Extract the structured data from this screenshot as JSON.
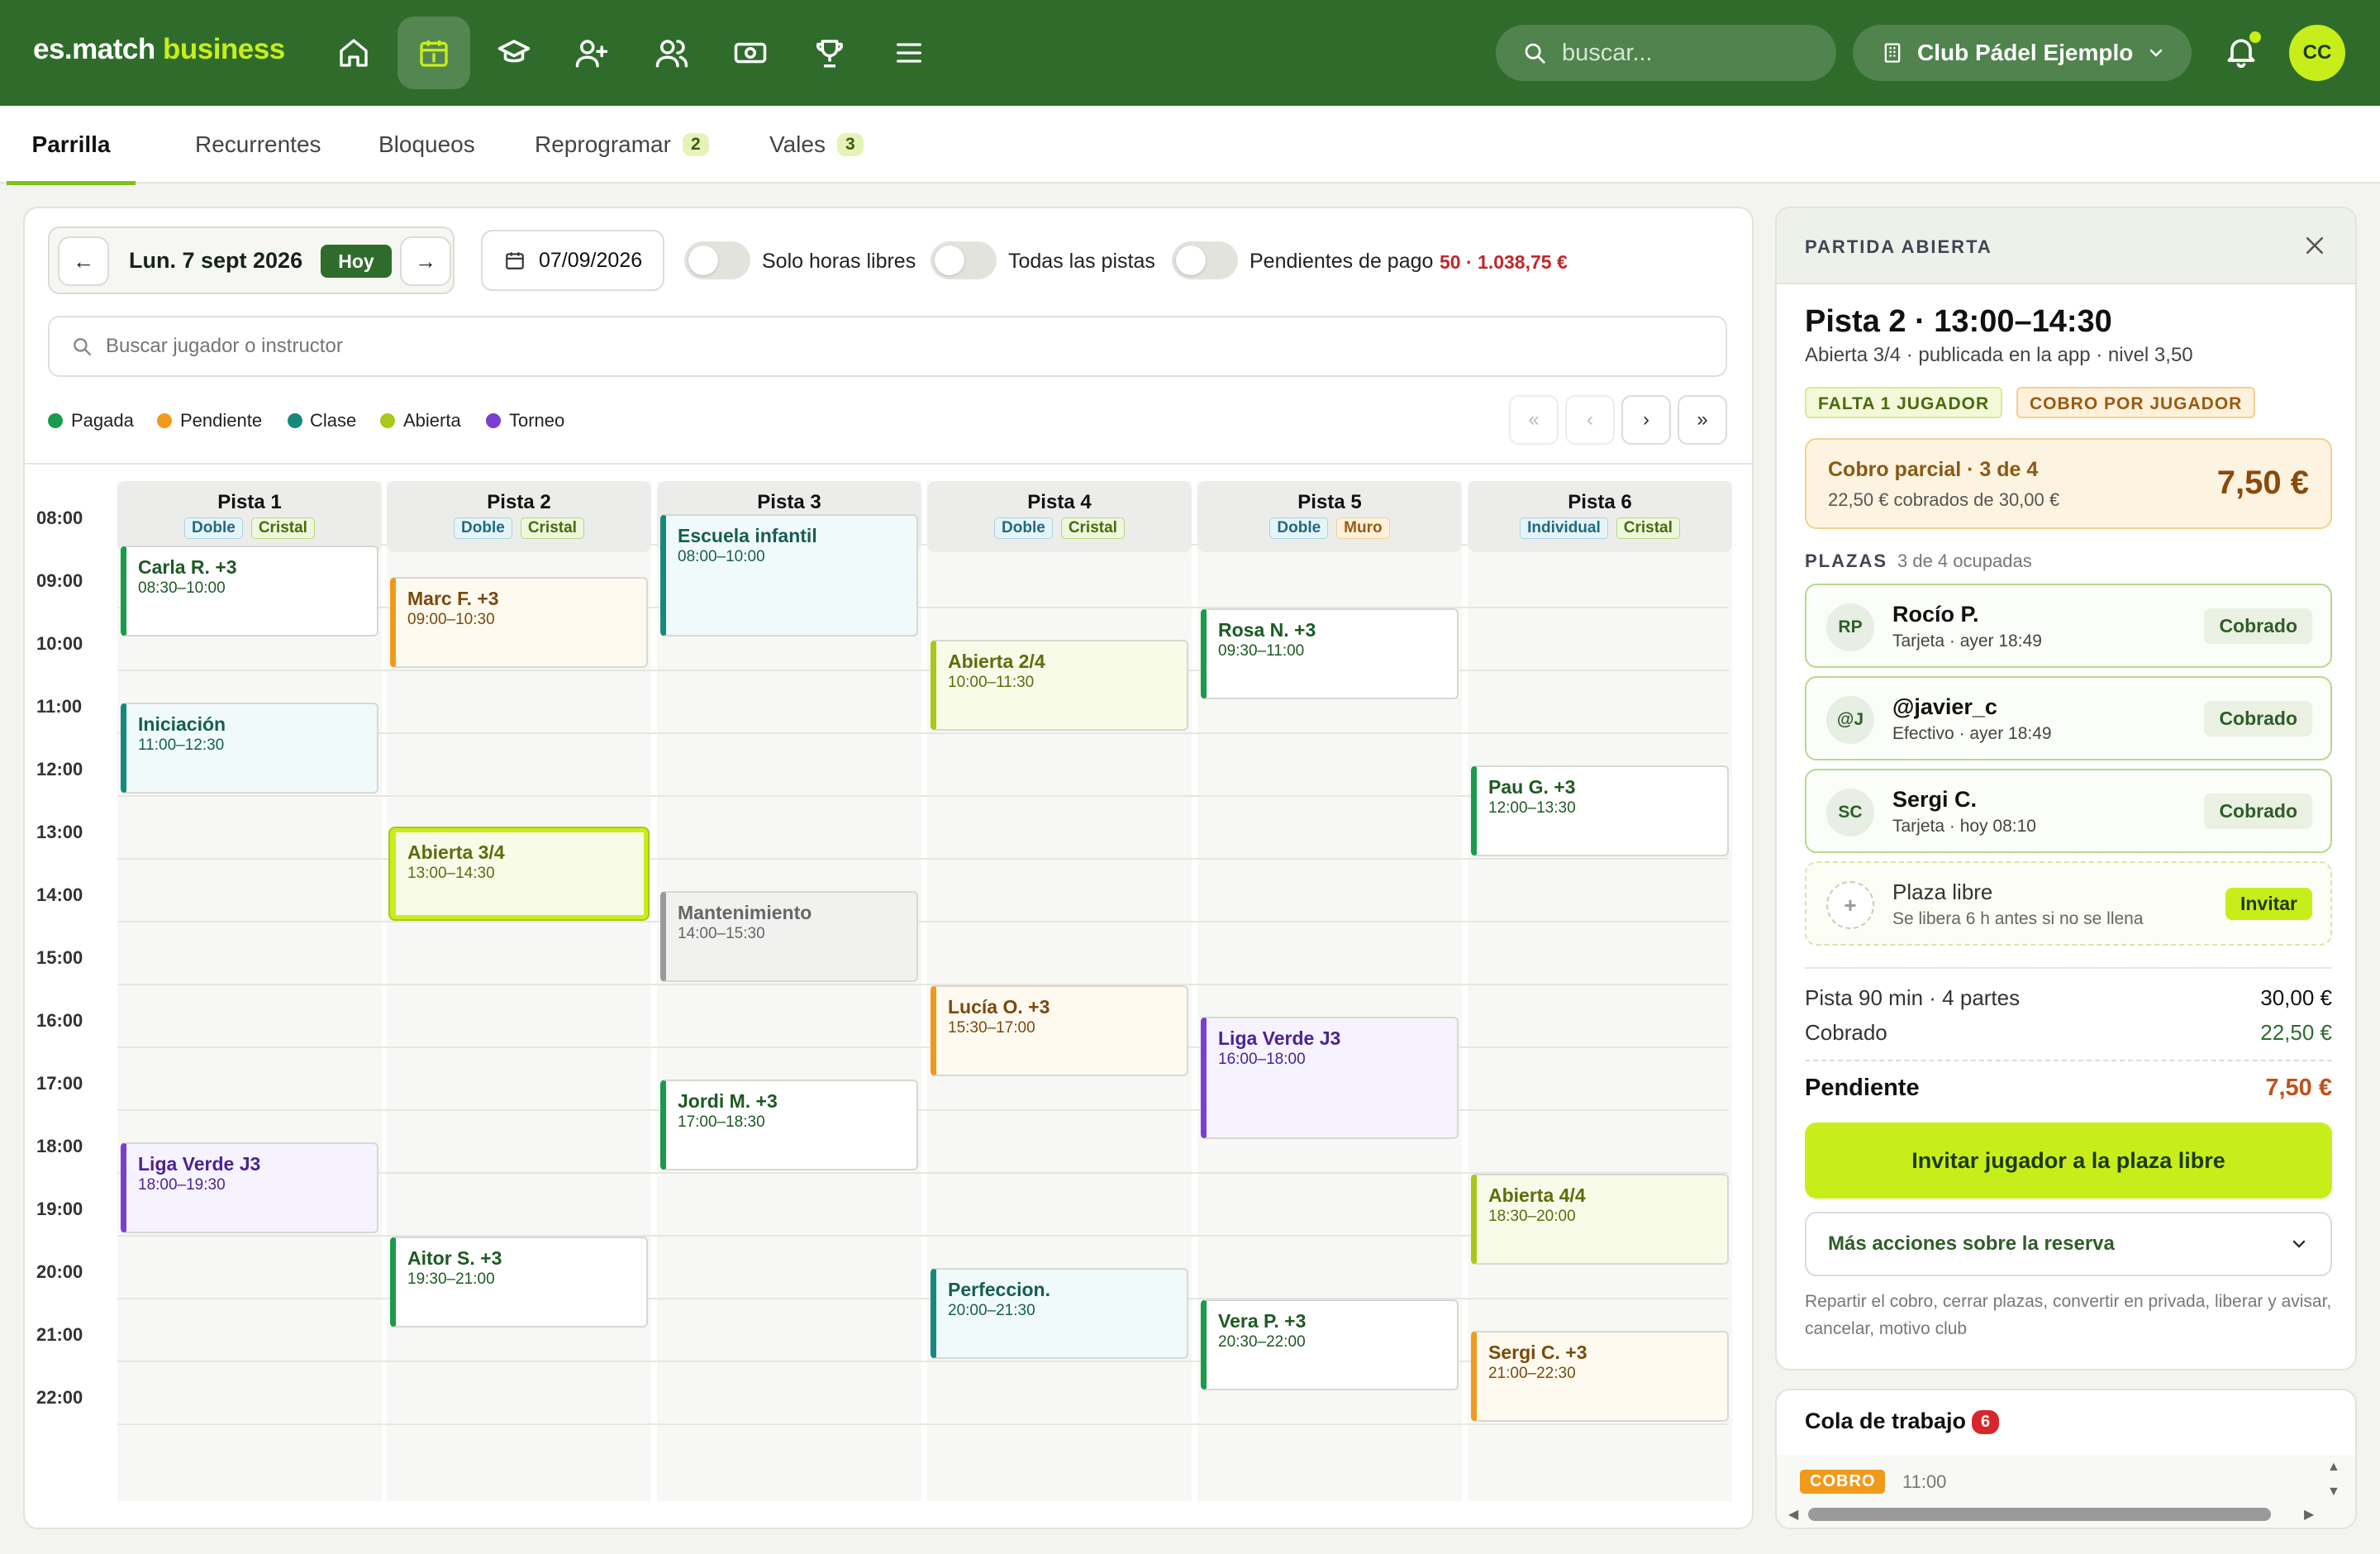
{
  "app": {
    "brand_a": "es.match",
    "brand_b": "business",
    "search_placeholder": "buscar...",
    "club": "Club Pádel Ejemplo",
    "user_initials": "CC",
    "accent": "#c7ee1a",
    "brand_color": "#2f6c2b"
  },
  "nav": [
    "home-icon",
    "calendar-icon",
    "graduation-cap-icon",
    "add-user-icon",
    "users-icon",
    "money-icon",
    "trophy-icon",
    "menu-icon"
  ],
  "tabs": {
    "t0": "Parrilla",
    "t1": "Recurrentes",
    "t2": "Bloqueos",
    "t3": "Reprogramar",
    "t3_badge": "2",
    "t4": "Vales",
    "t4_badge": "3"
  },
  "toolbar": {
    "date_label": "Lun. 7 sept 2026",
    "today": "Hoy",
    "prev": "←",
    "next": "→",
    "date_value": "07/09/2026",
    "toggle_free": "Solo horas libres",
    "toggle_all": "Todas las pistas",
    "toggle_pending": "Pendientes de pago",
    "pending_summary": "50 · 1.038,75 €",
    "player_search_placeholder": "Buscar jugador o instructor"
  },
  "legend": {
    "paid": "Pagada",
    "pending": "Pendiente",
    "class": "Clase",
    "open": "Abierta",
    "tournament": "Torneo"
  },
  "pager": {
    "first": "«",
    "prev": "‹",
    "next": "›",
    "last": "»"
  },
  "hours": [
    "08:00",
    "09:00",
    "10:00",
    "11:00",
    "12:00",
    "13:00",
    "14:00",
    "15:00",
    "16:00",
    "17:00",
    "18:00",
    "19:00",
    "20:00",
    "21:00",
    "22:00"
  ],
  "courts": [
    {
      "name": "Pista 1",
      "type": "Doble",
      "surface": "Cristal"
    },
    {
      "name": "Pista 2",
      "type": "Doble",
      "surface": "Cristal"
    },
    {
      "name": "Pista 3",
      "type": "Doble",
      "surface": "Cristal"
    },
    {
      "name": "Pista 4",
      "type": "Doble",
      "surface": "Cristal"
    },
    {
      "name": "Pista 5",
      "type": "Doble",
      "surface": "Muro"
    },
    {
      "name": "Pista 6",
      "type": "Individual",
      "surface": "Cristal"
    }
  ],
  "bookings": [
    {
      "court": 0,
      "start": 8.5,
      "end": 10,
      "title": "Carla R. +3",
      "time": "08:30–10:00",
      "status": "paid"
    },
    {
      "court": 0,
      "start": 11,
      "end": 12.5,
      "title": "Iniciación",
      "time": "11:00–12:30",
      "status": "class"
    },
    {
      "court": 0,
      "start": 18,
      "end": 19.5,
      "title": "Liga Verde J3",
      "time": "18:00–19:30",
      "status": "tournament"
    },
    {
      "court": 1,
      "start": 9,
      "end": 10.5,
      "title": "Marc F. +3",
      "time": "09:00–10:30",
      "status": "pending"
    },
    {
      "court": 1,
      "start": 13,
      "end": 14.5,
      "title": "Abierta 3/4",
      "time": "13:00–14:30",
      "status": "open",
      "selected": true
    },
    {
      "court": 1,
      "start": 19.5,
      "end": 21,
      "title": "Aitor S. +3",
      "time": "19:30–21:00",
      "status": "paid"
    },
    {
      "court": 2,
      "start": 8,
      "end": 10,
      "title": "Escuela infantil",
      "time": "08:00–10:00",
      "status": "class"
    },
    {
      "court": 2,
      "start": 14,
      "end": 15.5,
      "title": "Mantenimiento",
      "time": "14:00–15:30",
      "status": "block"
    },
    {
      "court": 2,
      "start": 17,
      "end": 18.5,
      "title": "Jordi M. +3",
      "time": "17:00–18:30",
      "status": "paid"
    },
    {
      "court": 3,
      "start": 10,
      "end": 11.5,
      "title": "Abierta 2/4",
      "time": "10:00–11:30",
      "status": "open"
    },
    {
      "court": 3,
      "start": 15.5,
      "end": 17,
      "title": "Lucía O. +3",
      "time": "15:30–17:00",
      "status": "pending"
    },
    {
      "court": 3,
      "start": 20,
      "end": 21.5,
      "title": "Perfeccion.",
      "time": "20:00–21:30",
      "status": "class"
    },
    {
      "court": 4,
      "start": 9.5,
      "end": 11,
      "title": "Rosa N. +3",
      "time": "09:30–11:00",
      "status": "paid"
    },
    {
      "court": 4,
      "start": 16,
      "end": 18,
      "title": "Liga Verde J3",
      "time": "16:00–18:00",
      "status": "tournament"
    },
    {
      "court": 4,
      "start": 20.5,
      "end": 22,
      "title": "Vera P. +3",
      "time": "20:30–22:00",
      "status": "paid"
    },
    {
      "court": 5,
      "start": 12,
      "end": 13.5,
      "title": "Pau G. +3",
      "time": "12:00–13:30",
      "status": "paid"
    },
    {
      "court": 5,
      "start": 18.5,
      "end": 20,
      "title": "Abierta 4/4",
      "time": "18:30–20:00",
      "status": "open"
    },
    {
      "court": 5,
      "start": 21,
      "end": 22.5,
      "title": "Sergi C. +3",
      "time": "21:00–22:30",
      "status": "pending"
    }
  ],
  "status_colors": {
    "paid": "#1a9b4b",
    "pending": "#f09a1c",
    "class": "#16897c",
    "open": "#a8c81a",
    "tournament": "#7a3fd1",
    "block": "#9a9a9a"
  },
  "panel": {
    "header": "PARTIDA ABIERTA",
    "title": "Pista 2 · 13:00–14:30",
    "subtitle": "Abierta 3/4 · publicada en la app · nivel 3,50",
    "badge1": "FALTA 1 JUGADOR",
    "badge2": "COBRO POR JUGADOR",
    "partial_title": "Cobro parcial · 3 de 4",
    "partial_sub": "22,50 € cobrados de 30,00 €",
    "partial_amount": "7,50 €",
    "plazas_label": "PLAZAS",
    "plazas_sub": "3 de 4 ocupadas",
    "players": [
      {
        "initials": "RP",
        "name": "Rocío P.",
        "detail": "Tarjeta · ayer 18:49",
        "status": "Cobrado"
      },
      {
        "initials": "@J",
        "name": "@javier_c",
        "detail": "Efectivo · ayer 18:49",
        "status": "Cobrado"
      },
      {
        "initials": "SC",
        "name": "Sergi C.",
        "detail": "Tarjeta · hoy 08:10",
        "status": "Cobrado"
      }
    ],
    "free_title": "Plaza libre",
    "free_sub": "Se libera 6 h antes si no se llena",
    "invite": "Invitar",
    "row1_label": "Pista 90 min · 4 partes",
    "row1_value": "30,00 €",
    "row2_label": "Cobrado",
    "row2_value": "22,50 €",
    "pending_label": "Pendiente",
    "pending_value": "7,50 €",
    "cta": "Invitar jugador a la plaza libre",
    "more": "Más acciones sobre la reserva",
    "help": "Repartir el cobro, cerrar plazas, convertir en privada, liberar y avisar, cancelar, motivo club"
  },
  "queue": {
    "title": "Cola de trabajo",
    "count": "6",
    "first_tag": "COBRO",
    "first_time": "11:00"
  }
}
